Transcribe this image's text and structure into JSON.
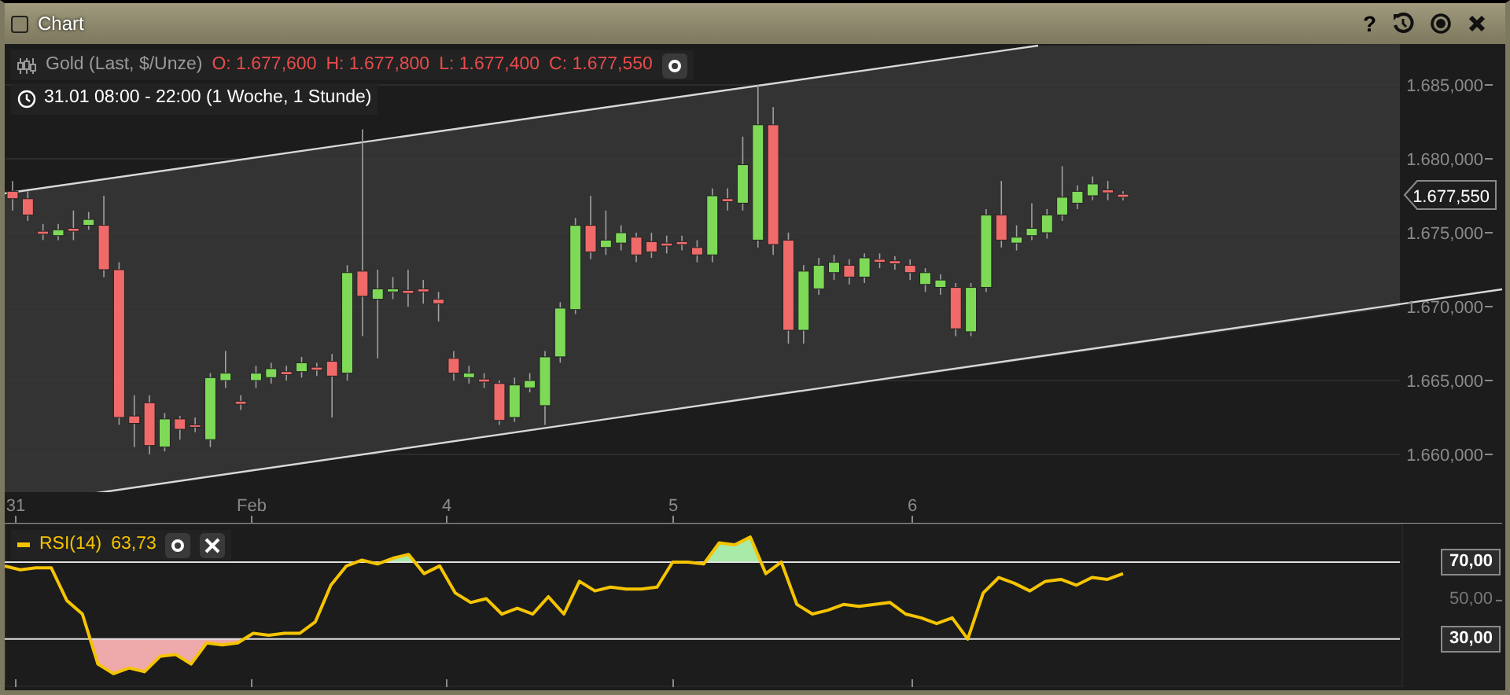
{
  "window": {
    "title": "Chart",
    "help_label": "?",
    "checkbox": {
      "checked": false
    }
  },
  "legend": {
    "instrument": "Gold (Last, $/Unze)",
    "open": "O: 1.677,600",
    "high": "H: 1.677,800",
    "low": "L: 1.677,400",
    "close": "C: 1.677,550",
    "period": "31.01 08:00 - 22:00 (1 Woche, 1 Stunde)"
  },
  "price_axis": {
    "ticks": [
      "1.685,000",
      "1.680,000",
      "1.675,000",
      "1.670,000",
      "1.665,000",
      "1.660,000"
    ],
    "last_price": "1.677,550"
  },
  "time_axis": {
    "labels": [
      "31",
      "Feb",
      "4",
      "5",
      "6"
    ]
  },
  "rsi": {
    "value": "63,73",
    "axis_labels": [
      {
        "highlighted": true
      },
      {
        "highlighted": false
      },
      {
        "highlighted": true
      }
    ],
    "chart_data": {
      "type": "line",
      "ylim": [
        5,
        90
      ],
      "yticks": [
        {
          "value": 70,
          "label": "70,00"
        },
        {
          "value": 50,
          "label": "50,00"
        },
        {
          "value": 30,
          "label": "30,00"
        }
      ],
      "categories": [
        null,
        null,
        null,
        null,
        null,
        null,
        null,
        null,
        null,
        null,
        null,
        null,
        null,
        null,
        null,
        null,
        null,
        null,
        null,
        null,
        null,
        null,
        null,
        null,
        null,
        null,
        null,
        null,
        null,
        null,
        null,
        null,
        null,
        null,
        null,
        null,
        null,
        null,
        null,
        null,
        null,
        null,
        null,
        null,
        null,
        null,
        null,
        null,
        null,
        null,
        null,
        null,
        null,
        null,
        null,
        null,
        null,
        null,
        null,
        null,
        null,
        null,
        null,
        null,
        null,
        null,
        null,
        null,
        null,
        null,
        null,
        null,
        null
      ],
      "series": [
        {
          "name": "RSI(14)",
          "color": "#f5c400",
          "values": [
            68,
            66,
            67,
            67,
            50,
            43,
            17,
            12,
            15,
            13,
            21,
            22,
            17,
            28,
            27,
            28,
            33,
            32,
            33,
            33,
            39,
            58,
            68,
            71,
            69,
            72,
            74,
            64,
            68,
            54,
            49,
            51,
            43,
            46,
            43,
            52,
            43,
            60,
            55,
            57,
            56,
            56,
            57,
            70,
            70,
            69,
            80,
            79,
            83,
            64,
            70,
            48,
            43,
            45,
            48,
            47,
            48,
            49,
            43,
            41,
            38,
            41,
            30,
            54,
            62,
            59,
            55,
            60,
            61,
            58,
            62,
            61,
            64
          ]
        }
      ]
    }
  }
}
